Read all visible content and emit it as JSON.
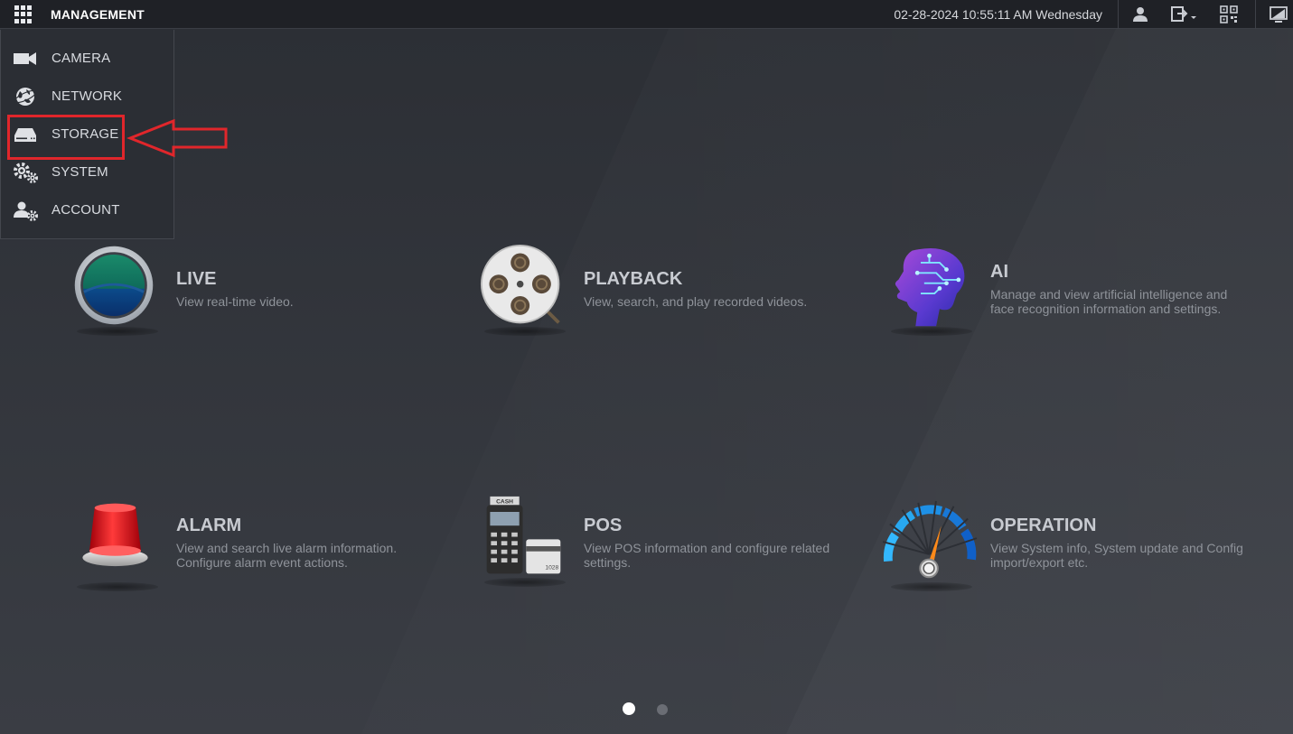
{
  "topbar": {
    "title": "MANAGEMENT",
    "datetime": "02-28-2024 10:55:11 AM Wednesday",
    "icons": [
      "apps-grid-icon",
      "user-icon",
      "logout-icon",
      "qr-code-icon",
      "monitor-icon"
    ]
  },
  "menu": {
    "items": [
      {
        "label": "CAMERA",
        "icon": "camera-icon"
      },
      {
        "label": "NETWORK",
        "icon": "globe-icon"
      },
      {
        "label": "STORAGE",
        "icon": "hdd-icon"
      },
      {
        "label": "SYSTEM",
        "icon": "gears-icon"
      },
      {
        "label": "ACCOUNT",
        "icon": "user-gear-icon"
      }
    ]
  },
  "tiles": [
    {
      "title": "LIVE",
      "desc": "View real-time video.",
      "icon": "live-lens-icon"
    },
    {
      "title": "PLAYBACK",
      "desc": "View, search, and play recorded videos.",
      "icon": "film-reel-icon"
    },
    {
      "title": "AI",
      "desc": "Manage and view artificial intelligence and face recognition information and settings.",
      "icon": "ai-head-icon"
    },
    {
      "title": "ALARM",
      "desc": "View and search live alarm information. Configure alarm event actions.",
      "icon": "alarm-siren-icon"
    },
    {
      "title": "POS",
      "desc": "View POS information and configure related settings.",
      "icon": "pos-terminal-icon"
    },
    {
      "title": "OPERATION",
      "desc": "View System info, System update and Config import/export etc.",
      "icon": "gauge-icon"
    }
  ],
  "pos_icon_text": {
    "cash": "CASH",
    "card": "1028"
  },
  "pager": {
    "pages": 2,
    "active": 1
  },
  "colors": {
    "highlight": "#e0262b",
    "topbar": "#1f2126",
    "background": "#33363d"
  }
}
